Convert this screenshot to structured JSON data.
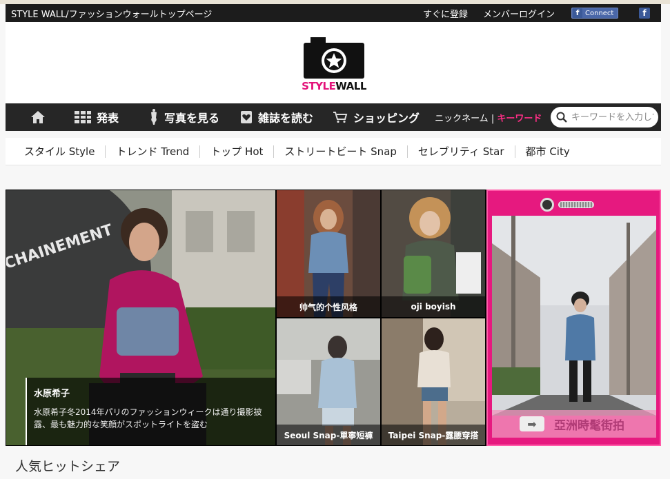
{
  "topbar": {
    "title": "STYLE WALL/ファッションウォールトップページ",
    "register": "すぐに登録",
    "login": "メンバーログイン",
    "fb_connect": "Connect",
    "fb_letter": "f"
  },
  "logo": {
    "style": "STYLE",
    "wall": "WALL"
  },
  "nav": {
    "items": [
      {
        "label": "発表",
        "icon": "grid-icon"
      },
      {
        "label": "写真を見る",
        "icon": "mannequin-icon"
      },
      {
        "label": "雑誌を読む",
        "icon": "magazine-heart-icon"
      },
      {
        "label": "ショッピング",
        "icon": "cart-icon"
      }
    ],
    "nickname": "ニックネーム",
    "separator": "|",
    "keyword": "キーワード",
    "search_placeholder": "キーワードを入力して"
  },
  "subnav": {
    "items": [
      "スタイル Style",
      "トレンド Trend",
      "トップ Hot",
      "ストリートビート Snap",
      "セレブリティ Star",
      "都市 City"
    ]
  },
  "feature": {
    "name": "水原希子",
    "description": "水原希子冬2014年パリのファッションウィークは通り撮影披露、最も魅力的な笑顔がスポットライトを盗む",
    "sign_text": "CHAINEMENT"
  },
  "tiles": [
    {
      "caption": "帅气的个性风格"
    },
    {
      "caption": "oji boyish"
    },
    {
      "caption": "Seoul Snap-單寧短褲"
    },
    {
      "caption": "Taipei Snap-露腰穿搭"
    }
  ],
  "side_promo": {
    "label": "亞洲時髦街拍",
    "arrow": "➡"
  },
  "section": {
    "title": "人気ヒットシェア"
  },
  "colors": {
    "brand_pink": "#e6197f",
    "nav_dark": "#262626",
    "keyword_pink": "#ff2e86"
  }
}
